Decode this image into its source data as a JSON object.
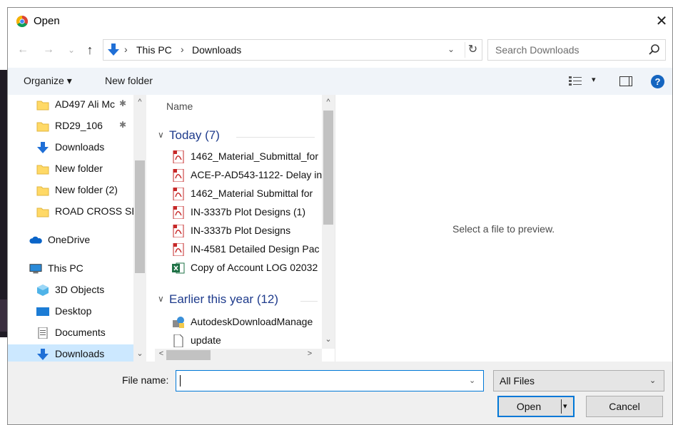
{
  "window": {
    "title": "Open",
    "close": "✕"
  },
  "nav": {
    "back": "←",
    "forward": "→",
    "recent": "⌄",
    "up": "↑"
  },
  "address": {
    "crumbs": [
      "This PC",
      "Downloads"
    ],
    "separator": "›",
    "dropdown": "⌄",
    "refresh": "↻"
  },
  "search": {
    "placeholder": "Search Downloads"
  },
  "toolbar": {
    "organize": "Organize ▾",
    "new_folder": "New folder",
    "view_dropdown": "▾"
  },
  "sidebar": {
    "items": [
      {
        "label": "AD497 Ali Mc",
        "icon": "folder-icon",
        "pinned": true
      },
      {
        "label": "RD29_106",
        "icon": "folder-icon",
        "pinned": true
      },
      {
        "label": "Downloads",
        "icon": "download-icon",
        "pinned": false
      },
      {
        "label": "New folder",
        "icon": "folder-icon",
        "pinned": false
      },
      {
        "label": "New folder (2)",
        "icon": "folder-icon",
        "pinned": false
      },
      {
        "label": "ROAD CROSS SE",
        "icon": "folder-icon",
        "pinned": false
      },
      {
        "label": "OneDrive",
        "icon": "cloud-icon",
        "pinned": false
      },
      {
        "label": "This PC",
        "icon": "computer-icon",
        "pinned": false
      },
      {
        "label": "3D Objects",
        "icon": "cube-icon",
        "pinned": false
      },
      {
        "label": "Desktop",
        "icon": "desktop-icon",
        "pinned": false
      },
      {
        "label": "Documents",
        "icon": "document-icon",
        "pinned": false
      },
      {
        "label": "Downloads",
        "icon": "download-icon",
        "pinned": false
      }
    ],
    "pin_glyph": "📌",
    "scroll_up": "^",
    "scroll_down": "⌄"
  },
  "filelist": {
    "column_name": "Name",
    "groups": [
      {
        "label": "Today (7)",
        "files": [
          {
            "name": "1462_Material_Submittal_for",
            "type": "pdf"
          },
          {
            "name": "ACE-P-AD543-1122- Delay in",
            "type": "pdf"
          },
          {
            "name": "1462_Material Submittal for",
            "type": "pdf"
          },
          {
            "name": "IN-3337b Plot Designs (1)",
            "type": "pdf"
          },
          {
            "name": "IN-3337b Plot Designs",
            "type": "pdf"
          },
          {
            "name": "IN-4581 Detailed Design Pac",
            "type": "pdf"
          },
          {
            "name": "Copy of Account LOG 02032",
            "type": "excel"
          }
        ]
      },
      {
        "label": "Earlier this year (12)",
        "files": [
          {
            "name": "AutodeskDownloadManage",
            "type": "installer"
          },
          {
            "name": "update",
            "type": "blank"
          }
        ]
      }
    ],
    "scroll_up": "^",
    "scroll_down": "⌄",
    "scroll_left": "<",
    "scroll_right": ">"
  },
  "preview": {
    "message": "Select a file to preview."
  },
  "footer": {
    "file_name_label": "File name:",
    "file_name_value": "",
    "file_name_dropdown": "⌄",
    "file_type": "All Files",
    "file_type_dropdown": "⌄",
    "open_label": "Open",
    "open_dropdown": "▾",
    "cancel_label": "Cancel"
  },
  "colors": {
    "accent": "#0078d7",
    "group_header": "#1e3b8c",
    "toolbar_bg": "#f0f4f9",
    "selection": "#cce8ff",
    "folder": "#ffd966",
    "pdf": "#c62828",
    "excel": "#1e7145"
  }
}
